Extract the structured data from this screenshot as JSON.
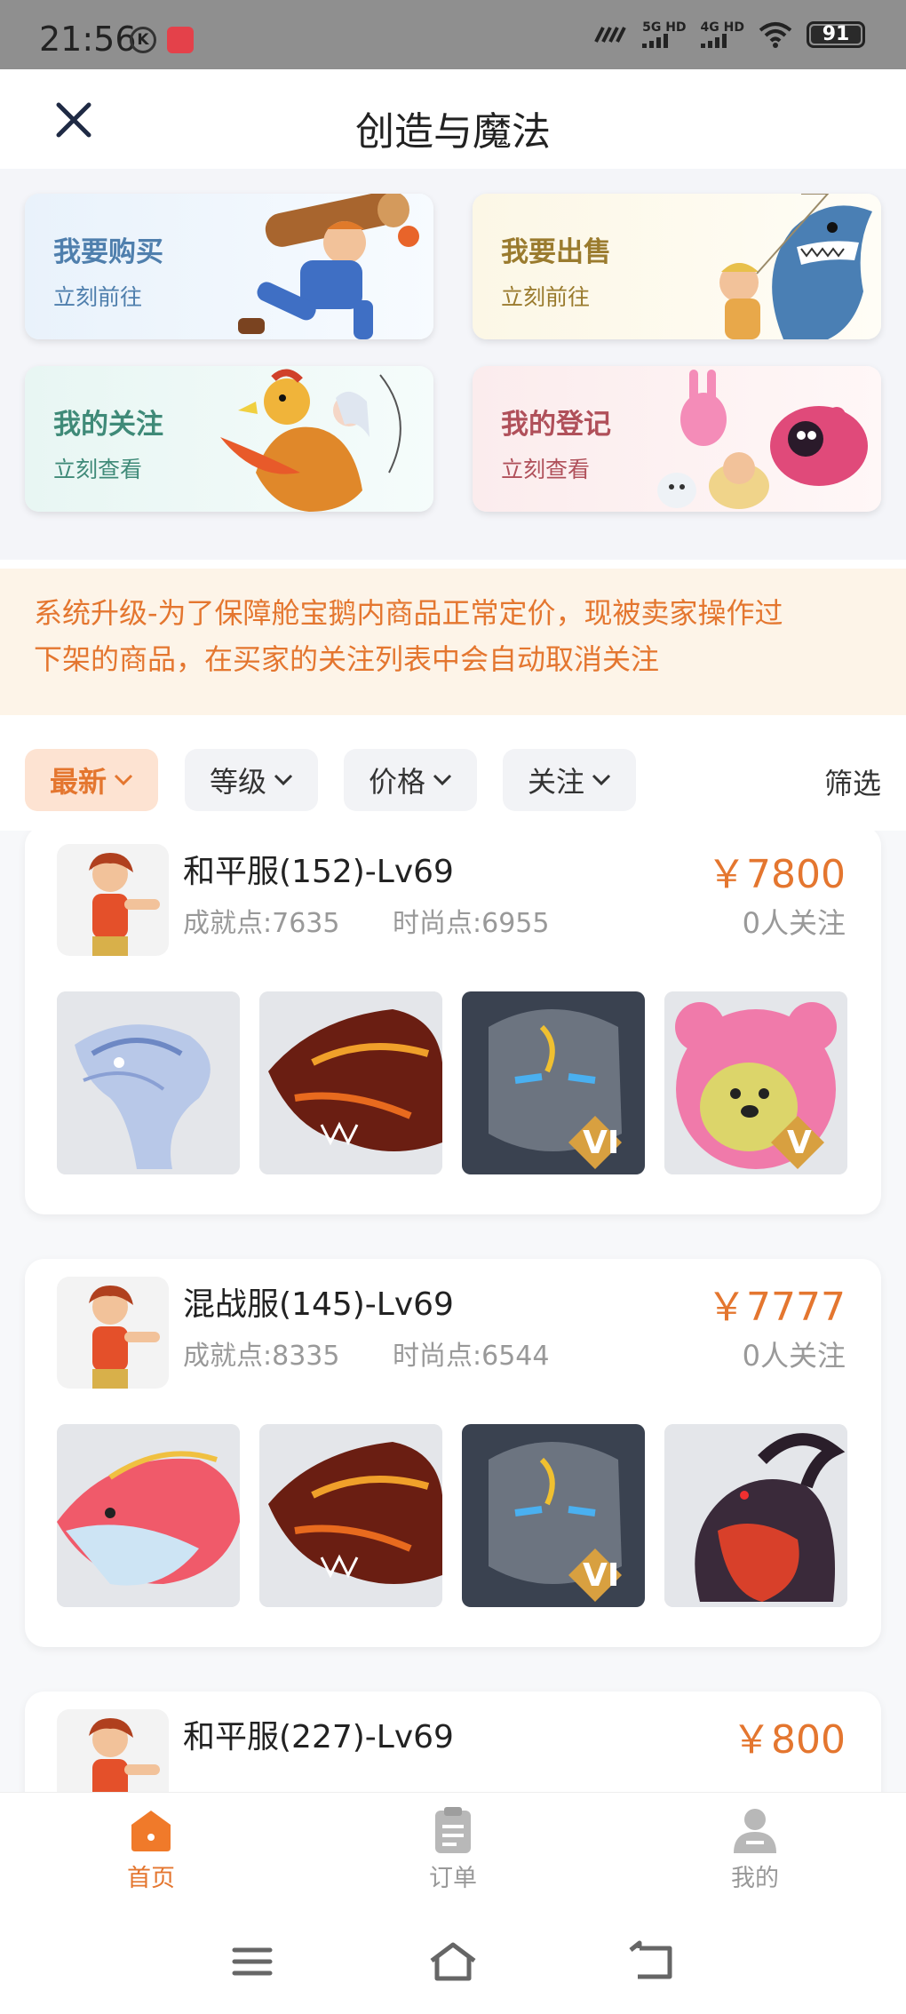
{
  "status_bar": {
    "time": "21:56",
    "k_badge": "K",
    "signal1": "5G HD",
    "signal2": "4G HD",
    "battery": "91"
  },
  "header": {
    "title": "创造与魔法"
  },
  "cards": {
    "buy": {
      "title": "我要购买",
      "subtitle": "立刻前往"
    },
    "sell": {
      "title": "我要出售",
      "subtitle": "立刻前往"
    },
    "follow": {
      "title": "我的关注",
      "subtitle": "立刻查看"
    },
    "register": {
      "title": "我的登记",
      "subtitle": "立刻查看"
    }
  },
  "notice": {
    "line1": "系统升级-为了保障舱宝鹅内商品正常定价，现被卖家操作过",
    "line2": "下架的商品，在买家的关注列表中会自动取消关注"
  },
  "filters": {
    "latest": "最新",
    "level": "等级",
    "price": "价格",
    "follow": "关注",
    "filter": "筛选"
  },
  "listings": [
    {
      "server": "和平服(152)-Lv69",
      "achievement": "成就点:7635",
      "fashion": "时尚点:6955",
      "price": "￥7800",
      "followers": "0人关注",
      "thumbs": [
        "blue-dragon",
        "fire-dragon",
        "armor-vi",
        "pink-bear-v"
      ]
    },
    {
      "server": "混战服(145)-Lv69",
      "achievement": "成就点:8335",
      "fashion": "时尚点:6544",
      "price": "￥7777",
      "followers": "0人关注",
      "thumbs": [
        "sky-fish",
        "fire-dragon",
        "armor-vi",
        "dark-beast"
      ]
    },
    {
      "server": "和平服(227)-Lv69",
      "price": "￥800"
    }
  ],
  "tabs": {
    "home": "首页",
    "orders": "订单",
    "mine": "我的"
  },
  "colors": {
    "accent": "#e4762f",
    "notice_bg": "#fdf4e8"
  }
}
